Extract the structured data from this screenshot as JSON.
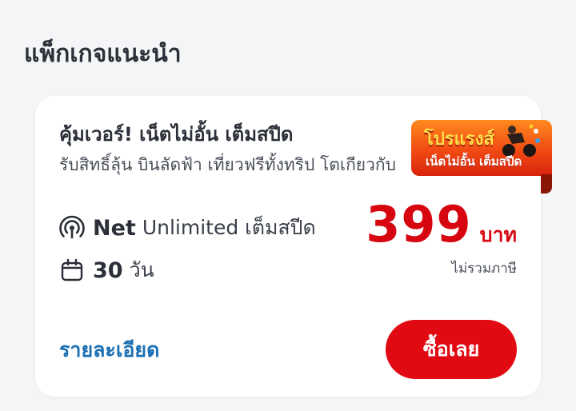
{
  "section": {
    "title": "แพ็กเกจแนะนำ"
  },
  "package": {
    "title": "คุ้มเวอร์! เน็ตไม่อั้น เต็มสปีด",
    "description": "รับสิทธิ์ลุ้น บินลัดฟ้า เที่ยวฟรีทั้งทริป โตเกียวกับ",
    "badge": {
      "line1": "โปรแรงส์",
      "line2": "เน็ตไม่อั้น เต็มสปีด"
    },
    "features": {
      "net_strong": "Net",
      "net_light": "Unlimited เต็มสปีด",
      "days_strong": "30",
      "days_light": "วัน"
    },
    "price": {
      "amount": "399",
      "unit": "บาท",
      "note": "ไม่รวมภาษี"
    },
    "details_label": "รายละเอียด",
    "buy_label": "ซื้อเลย"
  },
  "icons": {
    "net": "signal-broadcast-icon",
    "days": "calendar-icon"
  },
  "colors": {
    "accent_red": "#d7050f",
    "button_red": "#e20a12",
    "link_blue": "#1a6fb3",
    "background": "#f4f5f7"
  }
}
